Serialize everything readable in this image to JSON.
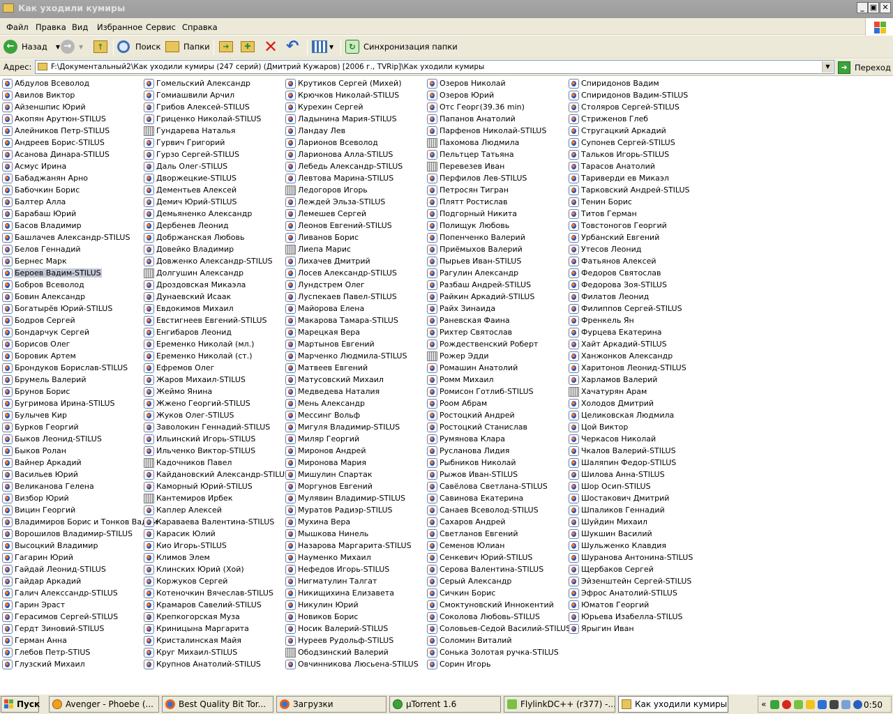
{
  "window": {
    "title": "Как уходили кумиры",
    "minimize": "_",
    "maximize": "▣",
    "close": "✕"
  },
  "menu": [
    "Файл",
    "Правка",
    "Вид",
    "Избранное",
    "Сервис",
    "Справка"
  ],
  "toolbar": {
    "back": "Назад",
    "search": "Поиск",
    "folders": "Папки",
    "sync": "Синхронизация папки"
  },
  "address": {
    "label": "Адрес:",
    "value": "F:\\Документальный2\\Как уходили кумиры (247 серий) (Дмитрий Кужаров) [2006 г., TVRip]\\Как уходили кумиры",
    "go": "Переход"
  },
  "files": {
    "selected": "Бероев Вадим-STILUS",
    "wmv_items": [
      "Гундарева Наталья",
      "Долгушин Александр",
      "Кадочников Павел",
      "Кантемиров Ирбек",
      "Ледогоров Игорь",
      "Лиепа Марис",
      "Ободзинский Валерий",
      "Пахомова Людмила",
      "Перевезев Иван",
      "Рожер Эдди",
      "Хачатурян Арам"
    ],
    "columns": [
      [
        "Абдулов Всеволод",
        "Авилов Виктор",
        "Айзеншпис Юрий",
        "Акопян Арутюн-STILUS",
        "Алейников Петр-STILUS",
        "Андреев Борис-STILUS",
        "Асанова Динара-STILUS",
        "Асмус Ирина",
        "Бабаджанян Арно",
        "Бабочкин Борис",
        "Балтер Алла",
        "Барабаш Юрий",
        "Басов Владимир",
        "Башлачев Александр-STILUS",
        "Белов Геннадий",
        "Бернес Марк",
        "Бероев Вадим-STILUS",
        "Бобров Всеволод",
        "Бовин Александр",
        "Богатырёв Юрий-STILUS",
        "Бодров Сергей",
        "Бондарчук Сергей",
        "Борисов Олег",
        "Боровик Артем",
        "Брондуков Борислав-STILUS",
        "Брумель Валерий",
        "Брунов Борис",
        "Бугримова Ирина-STILUS",
        "Булычев Кир",
        "Бурков Георгий",
        "Быков Леонид-STILUS",
        "Быков Ролан",
        "Вайнер Аркадий",
        "Васильев Юрий",
        "Великанова Гелена",
        "Визбор Юрий",
        "Вицин Георгий",
        "Владимиров Борис и Тонков Вадим",
        "Ворошилов Владимир-STILUS",
        "Высоцкий Владимир",
        "Гагарин Юрий",
        "Гайдай Леонид-STILUS",
        "Гайдар Аркадий",
        "Галич Алекссандр-STILUS",
        "Гарин Эраст",
        "Герасимов Сергей-STILUS",
        "Гердт Зиновий-STILUS",
        "Герман Анна",
        "Глебов Петр-STIUS",
        "Глузский Михаил"
      ],
      [
        "Гомельский Александр",
        "Гомиашвили Арчил",
        "Грибов Алексей-STILUS",
        "Гриценко Николай-STILUS",
        "Гундарева Наталья",
        "Гурвич Григорий",
        "Гурзо Сергей-STILUS",
        "Даль Олег-STILUS",
        "Дворжецкие-STILUS",
        "Дементьев Алексей",
        "Демич Юрий-STILUS",
        "Демьяненко Александр",
        "Дербенев Леонид",
        "Добржанская Любовь",
        "Довейко Владимир",
        "Довженко Александр-STILUS",
        "Долгушин Александр",
        "Дроздовская Микаэла",
        "Дунаевский Исаак",
        "Евдокимов Михаил",
        "Евстигнеев Евгений-STILUS",
        "Енгибаров Леонид",
        "Еременко Николай (мл.)",
        "Еременко Николай (ст.)",
        "Ефремов Олег",
        "Жаров Михаил-STILUS",
        "Жеймо Янина",
        "Жжено Георгий-STILUS",
        "Жуков Олег-STILUS",
        "Заволокин Геннадий-STILUS",
        "Ильинский Игорь-STILUS",
        "Ильченко Виктор-STILUS",
        "Кадочников Павел",
        "Кайдановский Александр-STILUS",
        "Каморный Юрий-STILUS",
        "Кантемиров Ирбек",
        "Каплер Алексей",
        "Караваева Валентина-STILUS",
        "Карасик Юлий",
        "Кио Игорь-STILUS",
        "Климов Элем",
        "Клинских Юрий (Хой)",
        "Коржуков Сергей",
        "Котеночкин Вячеслав-STILUS",
        "Крамаров Савелий-STILUS",
        "Крепкогорская Муза",
        "Криницына Маргарита",
        "Кристалинская Майя",
        "Круг Михаил-STILUS",
        "Крупнов Анатолий-STILUS"
      ],
      [
        "Крутиков Сергей (Михей)",
        "Крючков Николай-STILUS",
        "Курехин Сергей",
        "Ладынина Мария-STILUS",
        "Ландау Лев",
        "Ларионов Всеволод",
        "Ларионова Алла-STILUS",
        "Лебедь Александр-STILUS",
        "Левтова Марина-STILUS",
        "Ледогоров Игорь",
        "Леждей Эльза-STILUS",
        "Лемешев Сергей",
        "Леонов Евгений-STILUS",
        "Ливанов Борис",
        "Лиепа Марис",
        "Лихачев Дмитрий",
        "Лосев Александр-STILUS",
        "Лундстрем Олег",
        "Луспекаев Павел-STILUS",
        "Майорова Елена",
        "Макарова Тамара-STILUS",
        "Марецкая Вера",
        "Мартынов Евгений",
        "Марченко Людмила-STILUS",
        "Матвеев Евгений",
        "Матусовский Михаил",
        "Медведева Наталия",
        "Мень Александр",
        "Мессинг Вольф",
        "Мигуля Владимир-STILUS",
        "Миляр Георгий",
        "Миронов Андрей",
        "Миронова Мария",
        "Мишулин Спартак",
        "Моргунов Евгений",
        "Мулявин Владимир-STILUS",
        "Муратов Радиэр-STILUS",
        "Мухина Вера",
        "Мышкова Нинель",
        "Назарова Маргарита-STILUS",
        "Науменко Михаил",
        "Нефедов Игорь-STILUS",
        "Нигматулин Талгат",
        "Никищихина Елизавета",
        "Никулин Юрий",
        "Новиков Борис",
        "Носик Валерий-STILUS",
        "Нуреев Рудольф-STILUS",
        "Ободзинский Валерий",
        "Овчинникова Люсьена-STILUS"
      ],
      [
        "Озеров Николай",
        "Озеров Юрий",
        "Отс Георг(39.36 min)",
        "Папанов Анатолий",
        "Парфенов Николай-STILUS",
        "Пахомова Людмила",
        "Пельтцер Татьяна",
        "Перевезев Иван",
        "Перфилов Лев-STILUS",
        "Петросян Тигран",
        "Плятт Ростислав",
        "Подгорный Никита",
        "Полищук Любовь",
        "Попенченко Валерий",
        "Приёмыхов Валерий",
        "Пырьев Иван-STILUS",
        "Рагулин Александр",
        "Разбаш Андрей-STILUS",
        "Райкин Аркадий-STILUS",
        "Райх Зинаида",
        "Раневская Фаина",
        "Рихтер Святослав",
        "Рождественский Роберт",
        "Рожер Эдди",
        "Ромашин Анатолий",
        "Ромм Михаил",
        "Ромисон Готлиб-STILUS",
        "Роом Абрам",
        "Ростоцкий Андрей",
        "Ростоцкий Станислав",
        "Румянова Клара",
        "Русланова Лидия",
        "Рыбников Николай",
        "Рыжов Иван-STILUS",
        "Савёлова Светлана-STILUS",
        "Савинова Екатерина",
        "Санаев Всеволод-STILUS",
        "Сахаров Андрей",
        "Светланов Евгений",
        "Семенов Юлиан",
        "Сенкевич Юрий-STILUS",
        "Серова Валентина-STILUS",
        "Серый Александр",
        "Сичкин Борис",
        "Смоктуновский Иннокентий",
        "Соколова Любовь-STILUS",
        "Соловьев-Седой Василий-STILUS",
        "Соломин Виталий",
        "Сонька Золотая ручка-STILUS",
        "Сорин Игорь"
      ],
      [
        "Спиридонов Вадим",
        "Спиридонов Вадим-STILUS",
        "Столяров Сергей-STILUS",
        "Стриженов Глеб",
        "Стругацкий Аркадий",
        "Супонев Сергей-STILUS",
        "Тальков Игорь-STILUS",
        "Тарасов Анатолий",
        "Тариверди ев Микаэл",
        "Тарковский Андрей-STILUS",
        "Тенин Борис",
        "Титов Герман",
        "Товстоногов Георгий",
        "Урбанский Евгений",
        "Утесов Леонид",
        "Фатьянов Алексей",
        "Федоров Святослав",
        "Федорова Зоя-STILUS",
        "Филатов Леонид",
        "Филиппов Сергей-STILUS",
        "Френкель Ян",
        "Фурцева Екатерина",
        "Хайт Аркадий-STILUS",
        "Ханжонков Александр",
        "Харитонов Леонид-STILUS",
        "Харламов Валерий",
        "Хачатурян Арам",
        "Холодов Дмитрий",
        "Целиковская Людмила",
        "Цой Виктор",
        "Черкасов Николай",
        "Чкалов Валерий-STILUS",
        "Шаляпин Федор-STILUS",
        "Шилова Анна-STILUS",
        "Шор Осип-STILUS",
        "Шостакович Дмитрий",
        "Шпаликов Геннадий",
        "Шуйдин Михаил",
        "Шукшин Василий",
        "Шульженко Клавдия",
        "Шуранова Антонина-STILUS",
        "Щербаков Сергей",
        "Эйзенштейн Сергей-STILUS",
        "Эфрос Анатолий-STILUS",
        "Юматов Георгий",
        "Юрьева Изабелла-STILUS",
        "Ярыгин Иван"
      ]
    ]
  },
  "taskbar": {
    "start": "Пуск",
    "tasks": [
      "Avenger - Phoebe (...",
      "Best Quality Bit Tor...",
      "Загрузки",
      "µTorrent 1.6",
      "FlylinkDC++ (r377) -...",
      "Как уходили кумиры"
    ],
    "tray_toggle": "«",
    "clock": "0:50"
  }
}
